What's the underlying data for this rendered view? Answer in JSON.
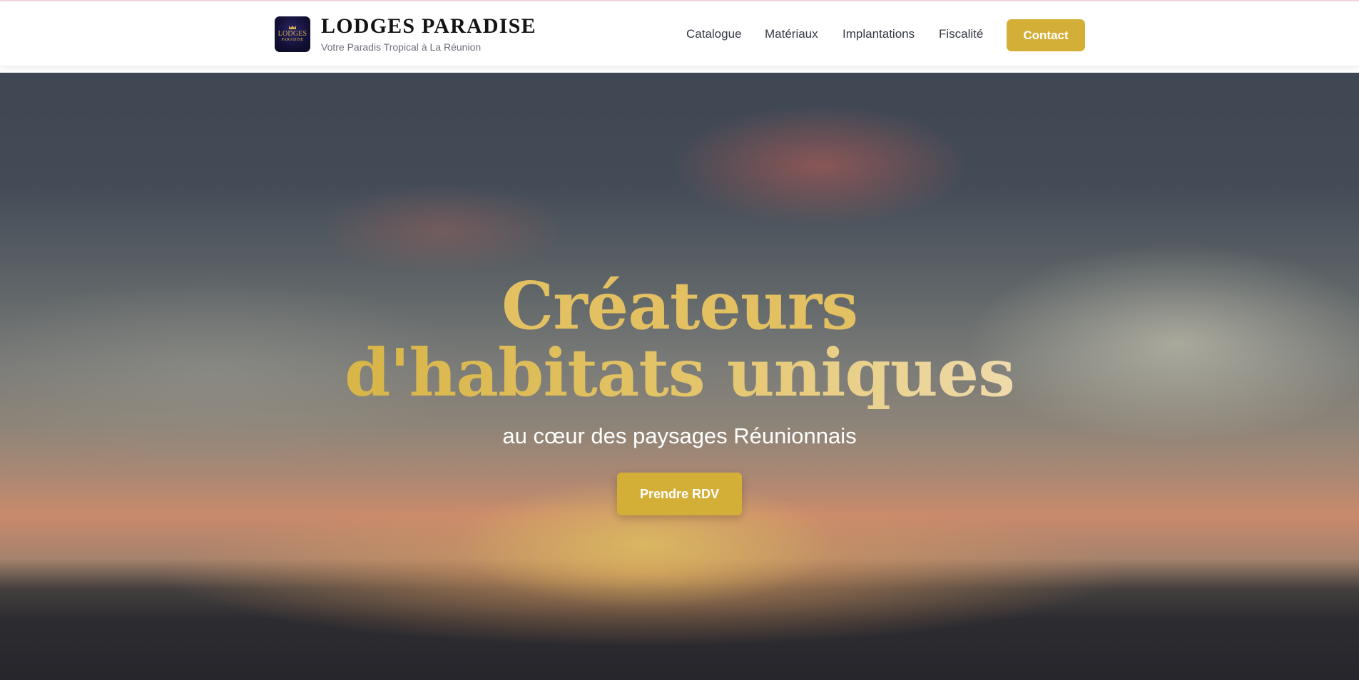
{
  "header": {
    "brand": {
      "logo_line1": "LODGES",
      "logo_line2": "PARADISE",
      "title": "LODGES PARADISE",
      "subtitle": "Votre Paradis Tropical à La Réunion"
    },
    "nav": {
      "items": [
        {
          "label": "Catalogue"
        },
        {
          "label": "Matériaux"
        },
        {
          "label": "Implantations"
        },
        {
          "label": "Fiscalité"
        }
      ],
      "contact_label": "Contact"
    }
  },
  "hero": {
    "title_line1": "Créateurs",
    "title_line2": "d'habitats uniques",
    "subtitle": "au cœur des paysages Réunionnais",
    "cta_label": "Prendre RDV"
  },
  "colors": {
    "accent_gold": "#d4af37",
    "brand_text": "#141414",
    "nav_text": "#333a45",
    "logo_bg": "#131036"
  }
}
